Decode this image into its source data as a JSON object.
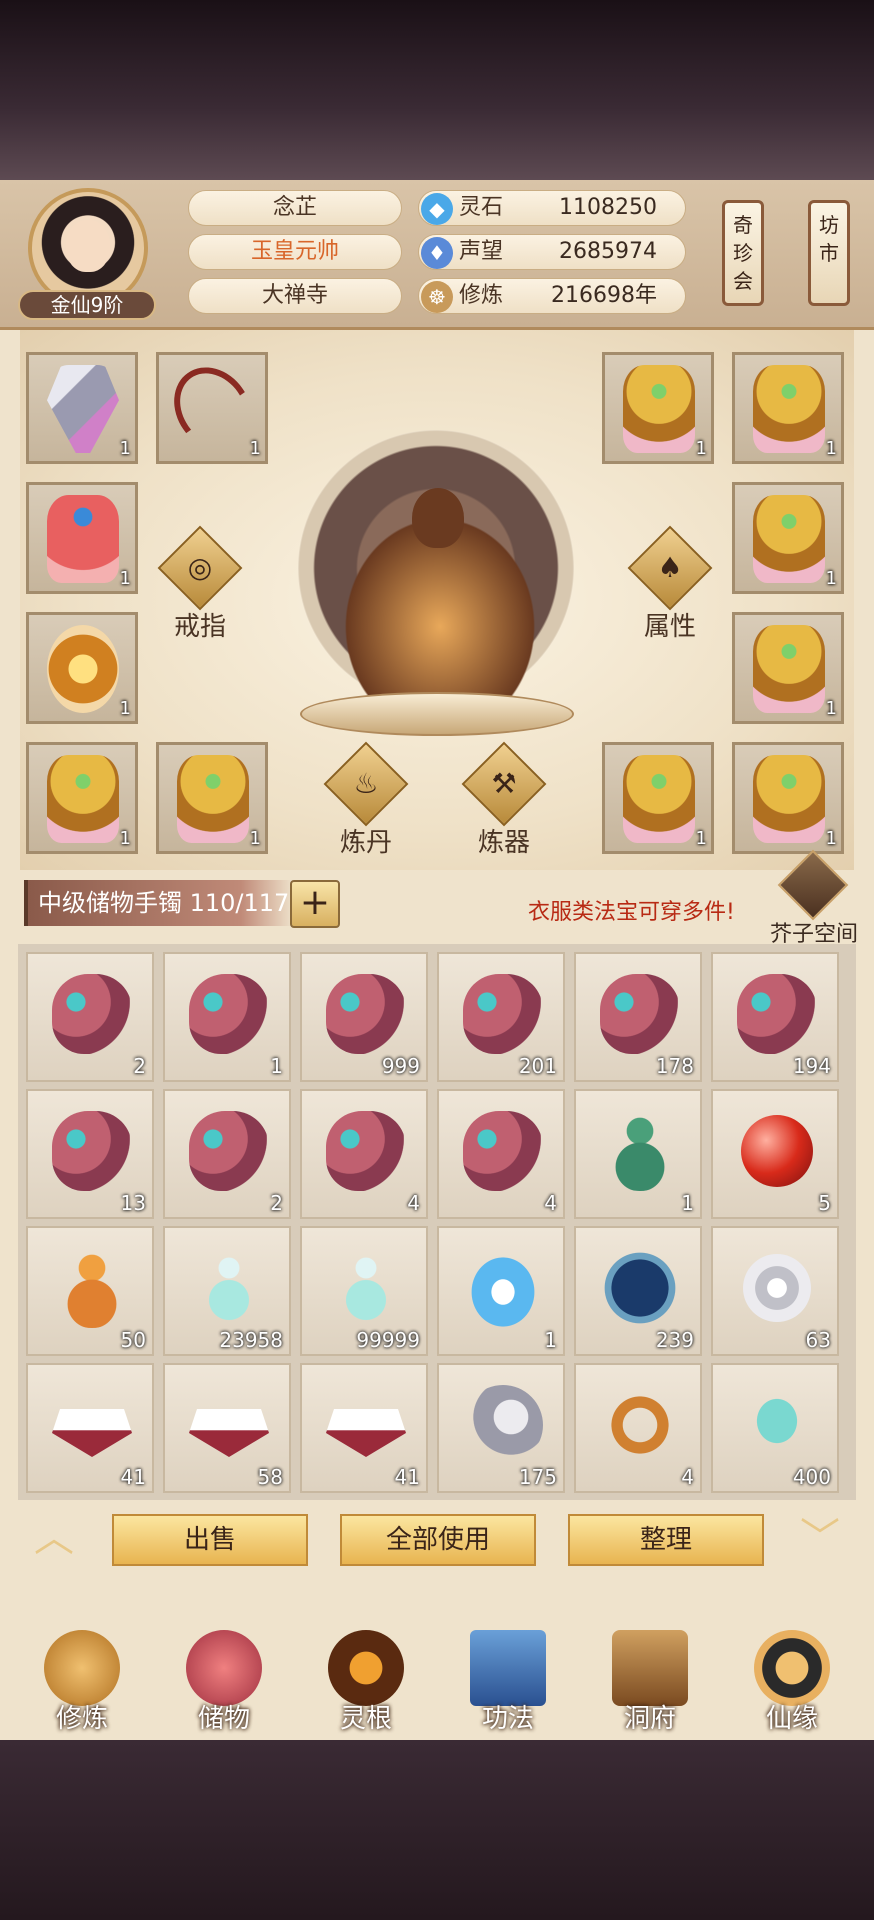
{
  "profile": {
    "rank": "金仙9阶",
    "name": "念芷",
    "title": "玉皇元帅",
    "sect": "大禅寺"
  },
  "stats": [
    {
      "icon": "spirit-stone-icon",
      "label": "灵石",
      "value": "1108250",
      "color": "#4aa8e8"
    },
    {
      "icon": "reputation-icon",
      "label": "声望",
      "value": "2685974",
      "color": "#5a8ad8"
    },
    {
      "icon": "cultivation-icon",
      "label": "修炼",
      "value": "216698年",
      "color": "#c89a5a"
    }
  ],
  "side_buttons": {
    "treasure_fair": "奇珍会",
    "market": "坊市"
  },
  "equip_labels": {
    "ring": "戒指",
    "attributes": "属性",
    "alchemy": "炼丹",
    "forging": "炼器"
  },
  "equip_counts": [
    "1",
    "1",
    "1",
    "1",
    "1",
    "1",
    "1",
    "1",
    "1",
    "1",
    "1",
    "1"
  ],
  "storage": {
    "label": "中级储物手镯 110/117",
    "notice": "衣服类法宝可穿多件!",
    "mustard_space": "芥子空间"
  },
  "inventory": [
    {
      "item": "pouch",
      "count": "2"
    },
    {
      "item": "pouch",
      "count": "1"
    },
    {
      "item": "pouch",
      "count": "999"
    },
    {
      "item": "pouch",
      "count": "201"
    },
    {
      "item": "pouch",
      "count": "178"
    },
    {
      "item": "pouch",
      "count": "194"
    },
    {
      "item": "pouch",
      "count": "13"
    },
    {
      "item": "pouch",
      "count": "2"
    },
    {
      "item": "pouch",
      "count": "4"
    },
    {
      "item": "pouch",
      "count": "4"
    },
    {
      "item": "green-gourd",
      "count": "1"
    },
    {
      "item": "red-orb",
      "count": "5"
    },
    {
      "item": "orange-gourd",
      "count": "50"
    },
    {
      "item": "potion-bottle",
      "count": "23958"
    },
    {
      "item": "potion-bottle",
      "count": "99999"
    },
    {
      "item": "tea-cup",
      "count": "1"
    },
    {
      "item": "star-disc",
      "count": "239"
    },
    {
      "item": "silver-swirl",
      "count": "63"
    },
    {
      "item": "rice-basket",
      "count": "41"
    },
    {
      "item": "rice-basket",
      "count": "58"
    },
    {
      "item": "rice-basket",
      "count": "41"
    },
    {
      "item": "silver-moon",
      "count": "175"
    },
    {
      "item": "gold-ring",
      "count": "4"
    },
    {
      "item": "jade-pendant",
      "count": "400"
    }
  ],
  "actions": {
    "sell": "出售",
    "use_all": "全部使用",
    "sort": "整理"
  },
  "nav": [
    "修炼",
    "储物",
    "灵根",
    "功法",
    "洞府",
    "仙缘"
  ]
}
